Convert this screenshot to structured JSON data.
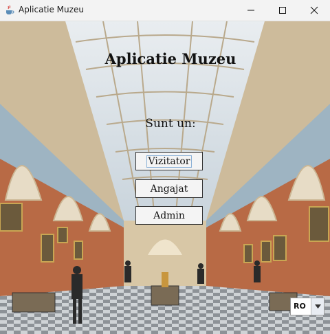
{
  "window": {
    "title": "Aplicatie Muzeu"
  },
  "main": {
    "heading": "Aplicatie Muzeu",
    "prompt": "Sunt un:",
    "buttons": {
      "visitor": "Vizitator",
      "employee": "Angajat",
      "admin": "Admin"
    }
  },
  "language": {
    "selected": "RO"
  },
  "icons": {
    "app": "java-cup-icon",
    "minimize": "minimize-icon",
    "maximize": "maximize-icon",
    "close": "close-icon",
    "dropdown": "chevron-down-icon"
  }
}
